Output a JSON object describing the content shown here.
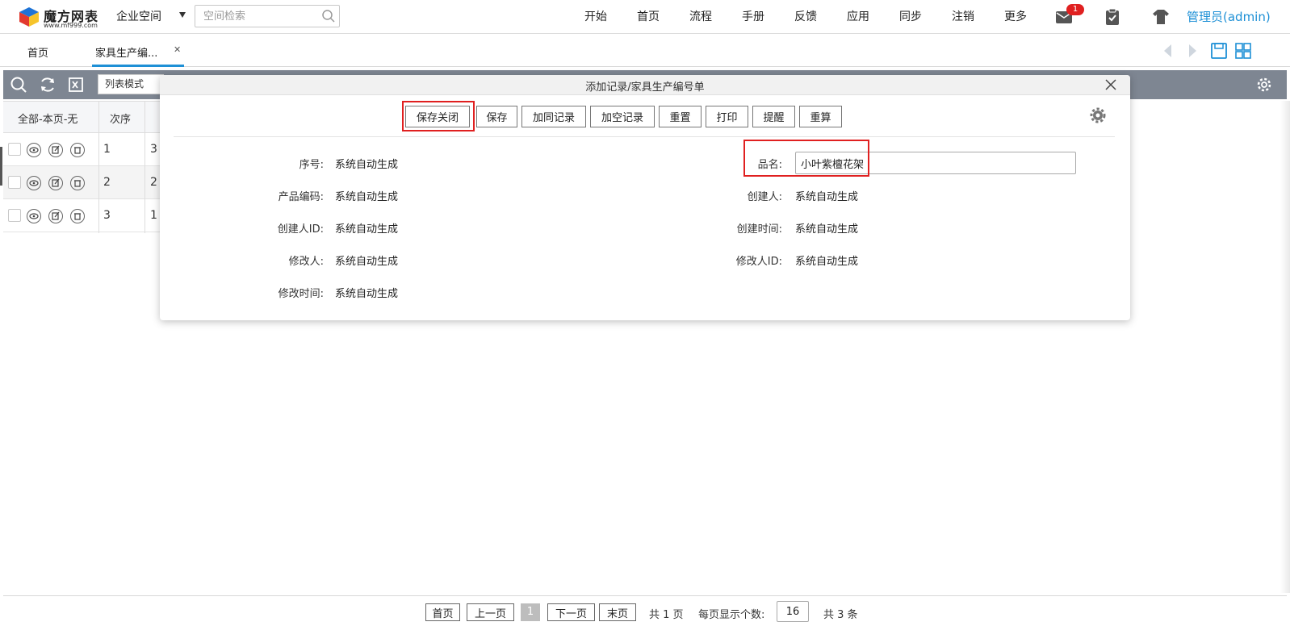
{
  "header": {
    "logo_name": "魔方网表",
    "logo_url": "www.mf999.com",
    "space_label": "企业空间",
    "space_search_placeholder": "空间检索",
    "nav": [
      "开始",
      "首页",
      "流程",
      "手册",
      "反馈",
      "应用",
      "同步",
      "注销",
      "更多"
    ],
    "mail_count": "1",
    "user": "管理员(admin)",
    "colors": {
      "accent": "#1e90d6",
      "badge": "#e02020"
    }
  },
  "tabs": {
    "home": "首页",
    "active": "家具生产编...",
    "close_symbol": "✕"
  },
  "toolbar": {
    "mode": "列表模式",
    "icons": [
      "search-icon",
      "refresh-icon",
      "excel-icon",
      "settings-icon"
    ]
  },
  "grid": {
    "headers": [
      "全部-本页-无",
      "次序"
    ],
    "rows": [
      {
        "order": "1",
        "clip": "3"
      },
      {
        "order": "2",
        "clip": "2"
      },
      {
        "order": "3",
        "clip": "1"
      }
    ]
  },
  "modal": {
    "title": "添加记录/家具生产编号单",
    "buttons": {
      "save_close": "保存关闭",
      "save": "保存",
      "add_same": "加同记录",
      "add_empty": "加空记录",
      "reset": "重置",
      "print": "打印",
      "remind": "提醒",
      "recalc": "重算"
    },
    "fields": {
      "seq_label": "序号:",
      "seq_value": "系统自动生成",
      "name_label": "品名:",
      "name_value": "小叶紫檀花架",
      "code_label": "产品编码:",
      "code_value": "系统自动生成",
      "creator_label": "创建人:",
      "creator_value": "系统自动生成",
      "creator_id_label": "创建人ID:",
      "creator_id_value": "系统自动生成",
      "created_label": "创建时间:",
      "created_value": "系统自动生成",
      "modifier_label": "修改人:",
      "modifier_value": "系统自动生成",
      "modifier_id_label": "修改人ID:",
      "modifier_id_value": "系统自动生成",
      "modified_label": "修改时间:",
      "modified_value": "系统自动生成"
    },
    "highlight_color": "#e02020"
  },
  "pager": {
    "first": "首页",
    "prev": "上一页",
    "current": "1",
    "next": "下一页",
    "last": "末页",
    "pages_text": "共 1 页",
    "page_size_label": "每页显示个数:",
    "page_size": "16",
    "total_text": "共 3 条"
  }
}
